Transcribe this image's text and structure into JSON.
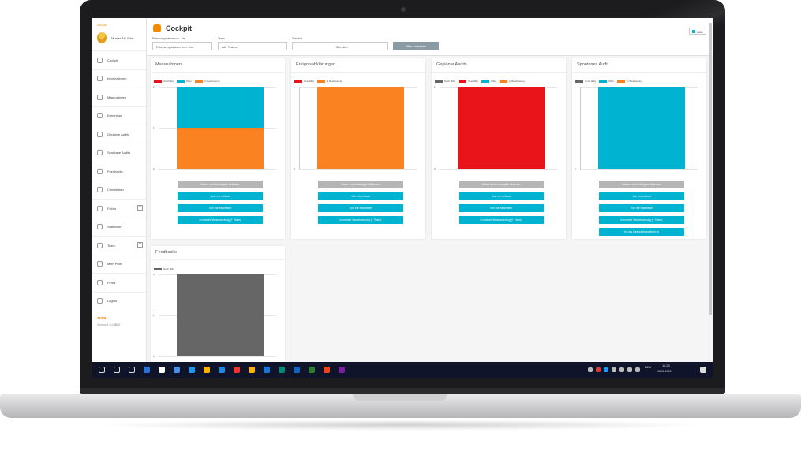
{
  "app": {
    "back": "zurück",
    "user": "Muster AG Sibe",
    "title": "Cockpit",
    "help": "Hilfe"
  },
  "filters": {
    "date_label": "Erfassungsdatum von - bis",
    "date_placeholder": "Erfassungsdatum von - bis",
    "team_label": "Team",
    "team_value": "Alle Teams",
    "site_label": "Standort",
    "site_value": "Standort",
    "reset": "Filter aufheben"
  },
  "nav": [
    {
      "label": "Cockpit",
      "icon": "bar-chart-icon"
    },
    {
      "label": "Informationen",
      "icon": "info-icon"
    },
    {
      "label": "Massnahmen",
      "icon": "tasks-icon"
    },
    {
      "label": "Ereignisse",
      "icon": "event-icon"
    },
    {
      "label": "Geplante Audits",
      "icon": "calendar-icon"
    },
    {
      "label": "Spontane Audits",
      "icon": "audit-icon"
    },
    {
      "label": "Feedbacks",
      "icon": "feedback-icon"
    },
    {
      "label": "Checklisten",
      "icon": "checklist-icon"
    },
    {
      "label": "Felder",
      "icon": "fields-icon"
    },
    {
      "label": "Standorte",
      "icon": "location-icon"
    },
    {
      "label": "Team",
      "icon": "team-icon"
    },
    {
      "label": "Mein Profil",
      "icon": "profile-icon"
    },
    {
      "label": "Firma",
      "icon": "company-icon"
    },
    {
      "label": "Logout",
      "icon": "logout-icon"
    }
  ],
  "brand": "suva",
  "version": "Version 1.8.0-f8bf0",
  "colors": {
    "red": "#e8141a",
    "teal": "#00b3d1",
    "orange": "#fb8221",
    "grey": "#666666"
  },
  "cards": [
    {
      "title": "Massnahmen",
      "legend": [
        "Überfällig",
        "Offen",
        "In Bearbeitung"
      ],
      "legend_colors": [
        "#e8141a",
        "#00b3d1",
        "#fb8221"
      ],
      "ticks": [
        "2",
        "1",
        "0"
      ],
      "stack": [
        {
          "color": "#fb8221",
          "value": 1
        },
        {
          "color": "#00b3d1",
          "value": 1
        }
      ],
      "ymax": 2,
      "buttons": [
        {
          "label": "Meine nicht erledigten Aktionen",
          "style": "grey"
        },
        {
          "label": "Von mir erfasst",
          "style": "teal"
        },
        {
          "label": "Von mir bearbeitet",
          "style": "teal"
        },
        {
          "label": "In meiner Verantwortung (+ Team)",
          "style": "teal"
        }
      ]
    },
    {
      "title": "Ereignisabklärungen",
      "legend": [
        "Überfällig",
        "In Bearbeitung"
      ],
      "legend_colors": [
        "#e8141a",
        "#fb8221"
      ],
      "ticks": [
        "1",
        "0"
      ],
      "stack": [
        {
          "color": "#fb8221",
          "value": 1
        }
      ],
      "ymax": 1,
      "buttons": [
        {
          "label": "Meine nicht erledigten Aktionen",
          "style": "grey"
        },
        {
          "label": "Von mir erfasst",
          "style": "teal"
        },
        {
          "label": "Von mir bearbeitet",
          "style": "teal"
        },
        {
          "label": "In meiner Verantwortung (+ Team)",
          "style": "teal"
        }
      ]
    },
    {
      "title": "Geplante Audits",
      "legend": [
        "Noch fällig",
        "Überfällig",
        "Offen",
        "In Bearbeitung"
      ],
      "legend_colors": [
        "#666666",
        "#e8141a",
        "#00b3d1",
        "#fb8221"
      ],
      "ticks": [
        "1",
        "0"
      ],
      "stack": [
        {
          "color": "#e8141a",
          "value": 1
        }
      ],
      "ymax": 1,
      "buttons": [
        {
          "label": "Meine nicht erledigten Aktionen",
          "style": "grey"
        },
        {
          "label": "Von mir erfasst",
          "style": "teal"
        },
        {
          "label": "Von mir bearbeitet",
          "style": "teal"
        },
        {
          "label": "In meiner Verantwortung (+ Team)",
          "style": "teal"
        }
      ]
    },
    {
      "title": "Spontanes Audit",
      "legend": [
        "Noch fällig",
        "Offen",
        "In Bearbeitung"
      ],
      "legend_colors": [
        "#666666",
        "#00b3d1",
        "#fb8221"
      ],
      "ticks": [
        "1",
        "0"
      ],
      "stack": [
        {
          "color": "#00b3d1",
          "value": 1
        }
      ],
      "ymax": 1,
      "buttons": [
        {
          "label": "Meine nicht erledigten Aktionen",
          "style": "grey"
        },
        {
          "label": "Von mir erfasst",
          "style": "teal"
        },
        {
          "label": "Von mir bearbeitet",
          "style": "teal"
        },
        {
          "label": "In meiner Verantwortung (+ Team)",
          "style": "teal"
        },
        {
          "label": "Ich als Gesprächspartner/-in",
          "style": "teal"
        }
      ]
    },
    {
      "title": "Feedbacks",
      "legend": [
        "Noch fällig"
      ],
      "legend_colors": [
        "#666666"
      ],
      "ticks": [
        "2",
        "1",
        "0"
      ],
      "stack": [
        {
          "color": "#666666",
          "value": 2
        }
      ],
      "ymax": 2,
      "buttons": []
    }
  ],
  "taskbar": {
    "lang": "DEU",
    "time": "11:23",
    "date": "08.06.2022"
  }
}
